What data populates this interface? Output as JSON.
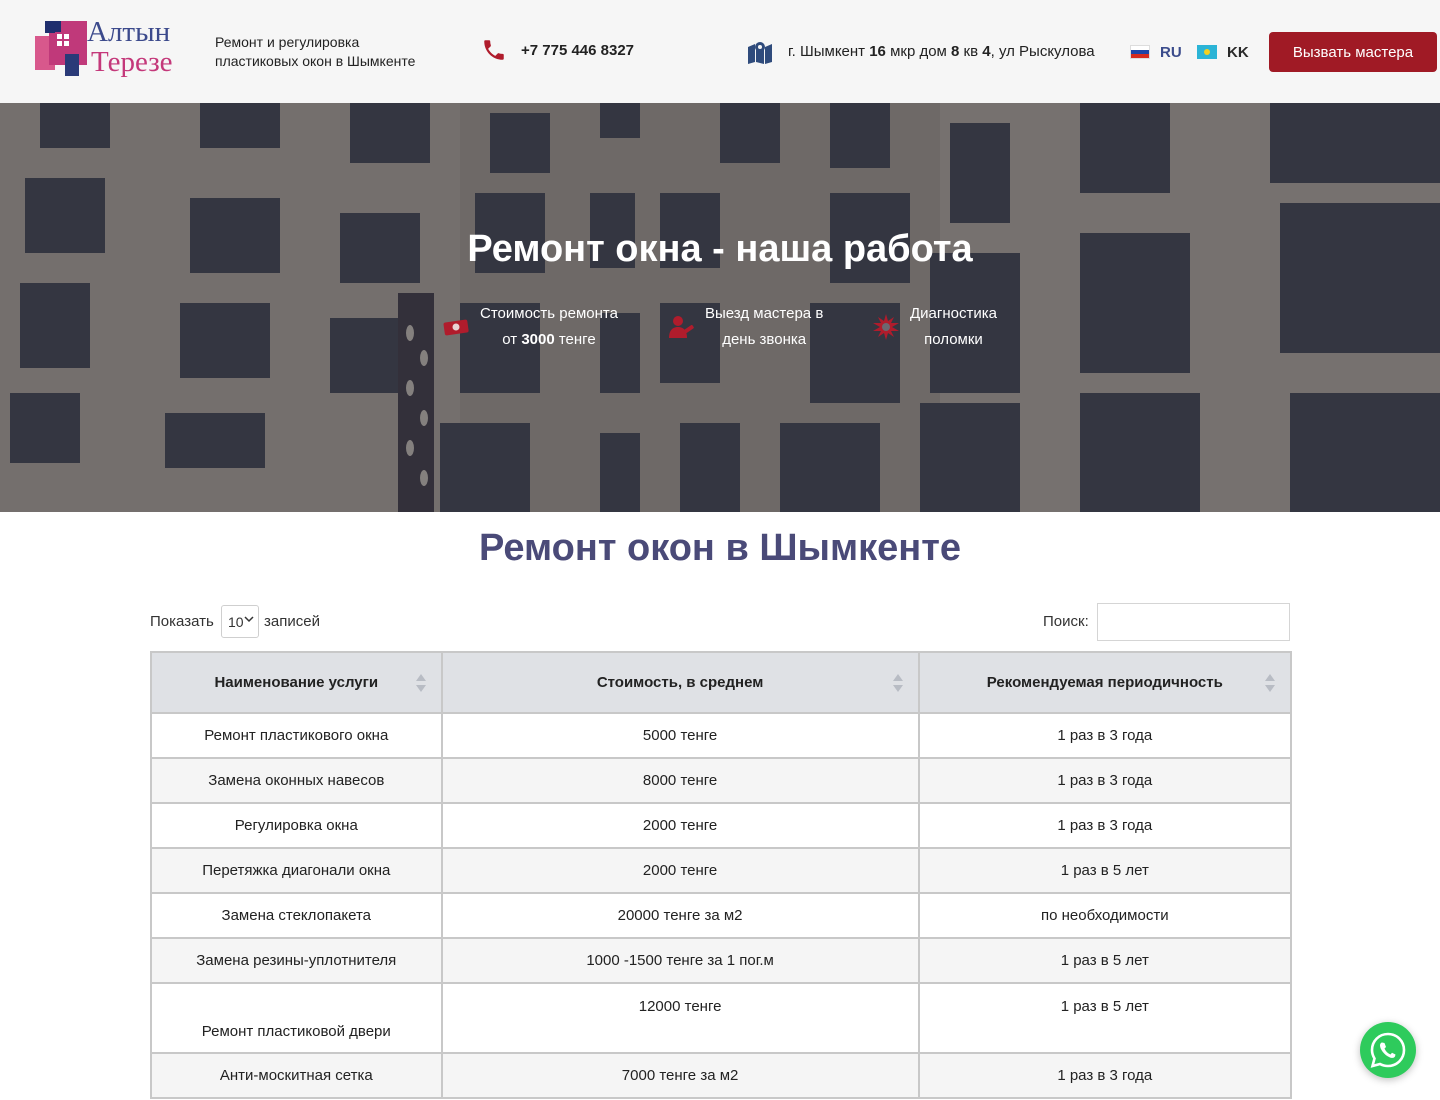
{
  "header": {
    "logo_line1": "Алтын",
    "logo_line2": "Терезе",
    "tagline": "Ремонт и регулировка пластиковых окон в Шымкенте",
    "phone": "+7 775 446 8327",
    "address_prefix": "г. Шымкент ",
    "address_mkr_num": "16",
    "address_mkr": " мкр дом ",
    "address_house": "8",
    "address_kv": " кв ",
    "address_flat": "4",
    "address_street": ", ул Рыскулова",
    "languages": [
      {
        "code": "RU",
        "flag": "flag-russia-icon",
        "active": true
      },
      {
        "code": "KK",
        "flag": "flag-kazakhstan-icon",
        "active": false
      }
    ],
    "call_button": "Вызвать мастера",
    "brand_color": "#a01a25"
  },
  "hero": {
    "title": "Ремонт окна - наша работа",
    "features": [
      {
        "icon": "money-icon",
        "line1": "Стоимость ремонта",
        "line2_prefix": "от ",
        "line2_bold": "3000",
        "line2_suffix": " тенге"
      },
      {
        "icon": "master-icon",
        "line1": "Выезд мастера в",
        "line2_prefix": "день звонка",
        "line2_bold": "",
        "line2_suffix": ""
      },
      {
        "icon": "diagnostics-gear-icon",
        "line1": "Диагностика",
        "line2_prefix": "поломки",
        "line2_bold": "",
        "line2_suffix": ""
      }
    ],
    "icon_color": "#b01c2c"
  },
  "section": {
    "title": "Ремонт окон в Шымкенте",
    "title_color": "#4a4a78"
  },
  "table_controls": {
    "show_label": "Показать",
    "page_length": "10",
    "records_label": "записей",
    "search_label": "Поиск:",
    "search_value": ""
  },
  "table": {
    "headers": [
      "Наименование услуги",
      "Стоимость, в среднем",
      "Рекомендуемая периодичность"
    ],
    "rows": [
      [
        "Ремонт пластикового окна",
        "5000 тенге",
        "1 раз в 3 года"
      ],
      [
        "Замена оконных навесов",
        "8000 тенге",
        "1 раз в 3 года"
      ],
      [
        "Регулировка окна",
        "2000 тенге",
        "1 раз в 3 года"
      ],
      [
        "Перетяжка диагонали окна",
        "2000 тенге",
        "1 раз в 5 лет"
      ],
      [
        "Замена стеклопакета",
        "20000 тенге за м2",
        "по необходимости"
      ],
      [
        "Замена резины-уплотнителя",
        "1000 -1500 тенге за 1 пог.м",
        "1 раз в 5 лет"
      ],
      [
        "Ремонт пластиковой двери",
        "12000 тенге",
        "1 раз в 5 лет"
      ],
      [
        "Анти-москитная сетка",
        "7000 тенге за м2",
        "1 раз в 3 года"
      ]
    ]
  },
  "floating": {
    "whatsapp_icon": "whatsapp-icon"
  }
}
